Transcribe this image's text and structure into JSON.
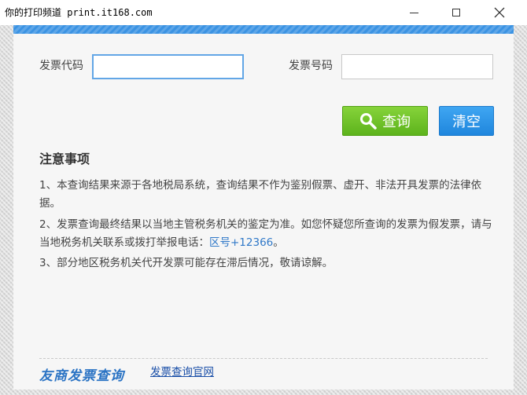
{
  "window": {
    "title": "你的打印频道 print.it168.com",
    "minimize_icon": "minimize-icon",
    "maximize_icon": "maximize-icon",
    "close_icon": "close-icon"
  },
  "form": {
    "invoice_code_label": "发票代码",
    "invoice_code_value": "",
    "invoice_number_label": "发票号码",
    "invoice_number_value": ""
  },
  "buttons": {
    "search_label": "查询",
    "search_icon": "search-icon",
    "clear_label": "清空"
  },
  "notes": {
    "title": "注意事项",
    "item1": "1、本查询结果来源于各地税局系统，查询结果不作为鉴别假票、虚开、非法开具发票的法律依据。",
    "item2_text": "2、发票查询最终结果以当地主管税务机关的鉴定为准。如您怀疑您所查询的发票为假发票，请与当地税务机关联系或拨打举报电话：",
    "item2_phone": "区号+12366",
    "item2_end": "。",
    "item3": "3、部分地区税务机关代开发票可能存在滞后情况，敬请谅解。"
  },
  "footer": {
    "logo_text": "友商发票查询",
    "link_text": "发票查询官网"
  },
  "colors": {
    "accent": "#3b93e3",
    "search_button": "#6cc027",
    "clear_button": "#2b93e6",
    "link": "#1a4fa8"
  }
}
